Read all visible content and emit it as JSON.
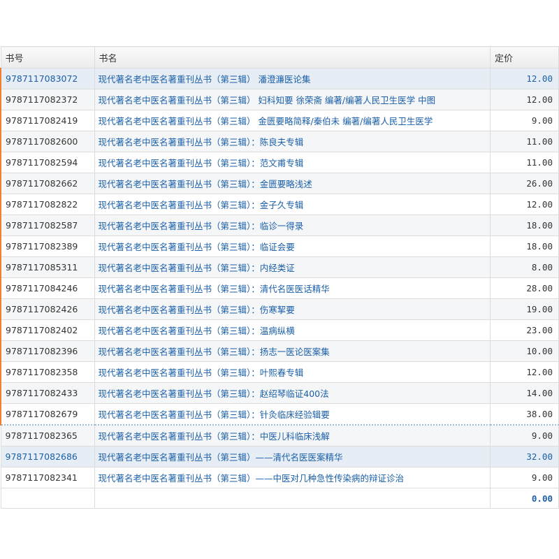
{
  "table": {
    "headers": {
      "isbn": "书号",
      "title": "书名",
      "price": "定价"
    },
    "rows": [
      {
        "isbn": "9787117083072",
        "title": "现代著名老中医名著重刊丛书（第三辑） 潘澄濂医论集",
        "price": "12.00"
      },
      {
        "isbn": "9787117082372",
        "title": "现代著名老中医名著重刊丛书（第三辑） 妇科知要 徐荣斋  编著/编著人民卫生医学 中图",
        "price": "12.00"
      },
      {
        "isbn": "9787117082419",
        "title": "现代著名老中医名著重刊丛书（第三辑） 金匮要略简释/秦伯未  编著/编著人民卫生医学",
        "price": "9.00"
      },
      {
        "isbn": "9787117082600",
        "title": "现代著名老中医名著重刊丛书（第三辑）：陈良夫专辑",
        "price": "11.00"
      },
      {
        "isbn": "9787117082594",
        "title": "现代著名老中医名著重刊丛书（第三辑）：范文甫专辑",
        "price": "11.00"
      },
      {
        "isbn": "9787117082662",
        "title": "现代著名老中医名著重刊丛书（第三辑）：金匮要略浅述",
        "price": "26.00"
      },
      {
        "isbn": "9787117082822",
        "title": "现代著名老中医名著重刊丛书（第三辑）：金子久专辑",
        "price": "12.00"
      },
      {
        "isbn": "9787117082587",
        "title": "现代著名老中医名著重刊丛书（第三辑）：临诊一得录",
        "price": "18.00"
      },
      {
        "isbn": "9787117082389",
        "title": "现代著名老中医名著重刊丛书（第三辑）：临证会要",
        "price": "18.00"
      },
      {
        "isbn": "9787117085311",
        "title": "现代著名老中医名著重刊丛书（第三辑）：内经类证",
        "price": "8.00"
      },
      {
        "isbn": "9787117084246",
        "title": "现代著名老中医名著重刊丛书（第三辑）：清代名医医话精华",
        "price": "28.00"
      },
      {
        "isbn": "9787117082426",
        "title": "现代著名老中医名著重刊丛书（第三辑）：伤寒挈要",
        "price": "19.00"
      },
      {
        "isbn": "9787117082402",
        "title": "现代著名老中医名著重刊丛书（第三辑）：温病纵横",
        "price": "23.00"
      },
      {
        "isbn": "9787117082396",
        "title": "现代著名老中医名著重刊丛书（第三辑）：扬志一医论医案集",
        "price": "10.00"
      },
      {
        "isbn": "9787117082358",
        "title": "现代著名老中医名著重刊丛书（第三辑）：叶熙春专辑",
        "price": "12.00"
      },
      {
        "isbn": "9787117082433",
        "title": "现代著名老中医名著重刊丛书（第三辑）：赵绍琴临证400法",
        "price": "14.00"
      },
      {
        "isbn": "9787117082679",
        "title": "现代著名老中医名著重刊丛书（第三辑）：针灸临床经验辑要",
        "price": "38.00"
      },
      {
        "isbn": "9787117082365",
        "title": "现代著名老中医名著重刊丛书（第三辑）：中医儿科临床浅解",
        "price": "9.00"
      },
      {
        "isbn": "9787117082686",
        "title": "现代著名老中医名著重刊丛书（第三辑）——清代名医医案精华",
        "price": "32.00"
      },
      {
        "isbn": "9787117082341",
        "title": "现代著名老中医名著重刊丛书（第三辑）——中医对几种急性传染病的辩证诊治",
        "price": "9.00"
      }
    ],
    "total": "0.00"
  },
  "colors": {
    "link": "#1a5fa8",
    "marker": "#f08030",
    "selected_row": "#e6edf5"
  }
}
